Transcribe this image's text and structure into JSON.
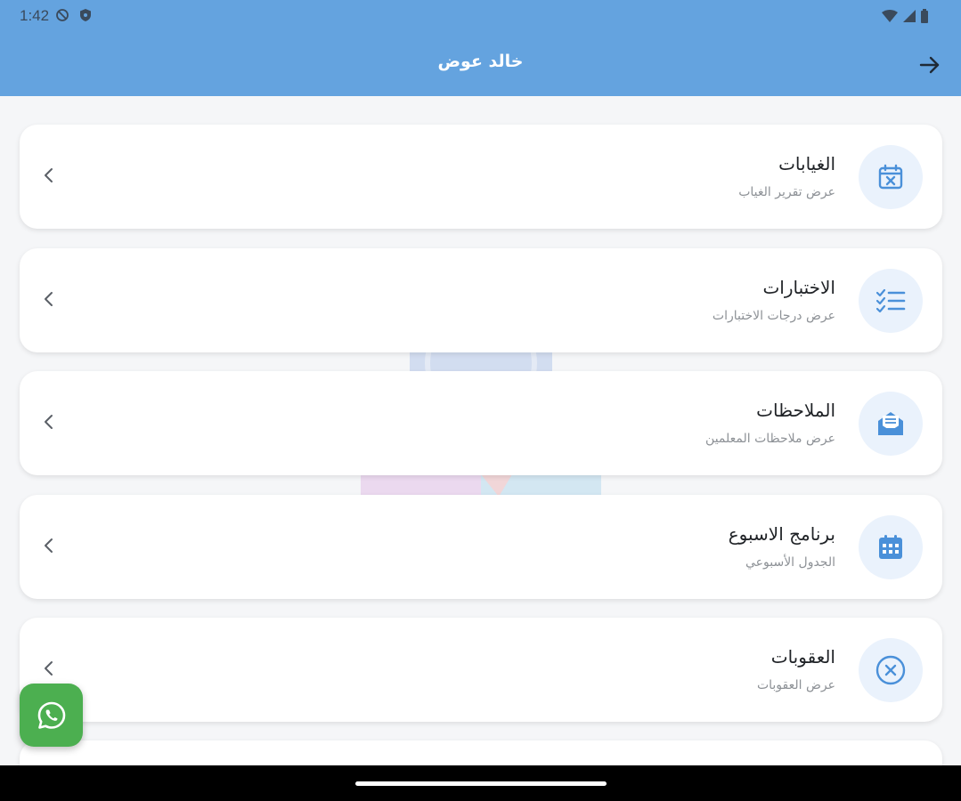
{
  "status_bar": {
    "time": "1:42",
    "left_icons": [
      "do-not-disturb-icon",
      "vpn-shield-icon"
    ],
    "right_icons": [
      "wifi-icon",
      "signal-icon",
      "battery-icon"
    ]
  },
  "app_bar": {
    "title": "خالد عوض",
    "back_icon": "arrow-right-icon",
    "color": "#64a3df"
  },
  "menu_items": [
    {
      "title": "الغيابات",
      "subtitle": "عرض تقرير الغياب",
      "icon": "calendar-x-icon"
    },
    {
      "title": "الاختبارات",
      "subtitle": "عرض درجات الاختبارات",
      "icon": "checklist-icon"
    },
    {
      "title": "الملاحظات",
      "subtitle": "عرض ملاحظات المعلمين",
      "icon": "envelope-open-icon"
    },
    {
      "title": "برنامج الاسبوع",
      "subtitle": "الجدول الأسبوعي",
      "icon": "calendar-grid-icon"
    },
    {
      "title": "العقوبات",
      "subtitle": "عرض العقوبات",
      "icon": "circle-x-icon"
    }
  ],
  "fab": {
    "icon": "whatsapp-icon",
    "color": "#4caf50"
  },
  "accent_color": "#4a90d9"
}
